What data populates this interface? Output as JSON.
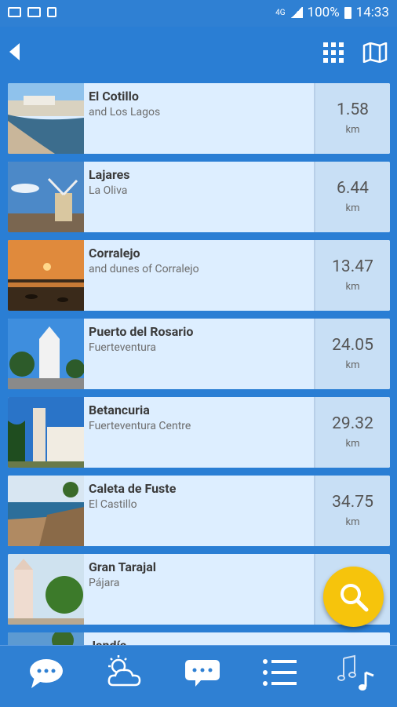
{
  "status_bar": {
    "network": "4G",
    "battery": "100%",
    "time": "14:33"
  },
  "places": [
    {
      "title": "El Cotillo",
      "subtitle": "and Los Lagos",
      "distance": "1.58",
      "unit": "km"
    },
    {
      "title": "Lajares",
      "subtitle": "La Oliva",
      "distance": "6.44",
      "unit": "km"
    },
    {
      "title": "Corralejo",
      "subtitle": "and dunes of Corralejo",
      "distance": "13.47",
      "unit": "km"
    },
    {
      "title": "Puerto del Rosario",
      "subtitle": "Fuerteventura",
      "distance": "24.05",
      "unit": "km"
    },
    {
      "title": "Betancuria",
      "subtitle": "Fuerteventura Centre",
      "distance": "29.32",
      "unit": "km"
    },
    {
      "title": "Caleta de Fuste",
      "subtitle": "El Castillo",
      "distance": "34.75",
      "unit": "km"
    },
    {
      "title": "Gran Tarajal",
      "subtitle": "Pájara",
      "distance": "",
      "unit": ""
    },
    {
      "title": "Jandía",
      "subtitle": "",
      "distance": "",
      "unit": ""
    }
  ],
  "icons": {
    "back": "back-arrow-icon",
    "grid": "grid-view-icon",
    "map": "map-icon",
    "search": "search-icon",
    "nav": [
      "chat-bubble-icon",
      "weather-icon",
      "message-icon",
      "list-icon",
      "music-icon"
    ]
  },
  "colors": {
    "primary": "#2f80d3",
    "card": "#ddeeff",
    "distance_panel": "#c8dff5",
    "fab": "#f6c40c"
  }
}
